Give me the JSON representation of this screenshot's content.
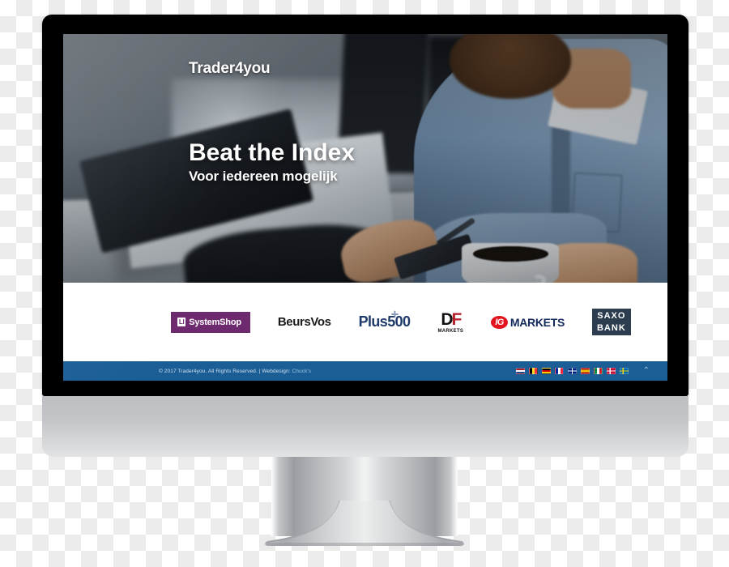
{
  "device": {
    "type": "desktop-monitor",
    "bezel_color": "#000000",
    "chin_color": "#c2c4c7",
    "stand_color": "#c9cbce"
  },
  "site": {
    "logo_text": "Trader4you",
    "hero": {
      "headline": "Beat the Index",
      "subheadline": "Voor iedereen mogelijk",
      "image_description": "bearded man in denim shirt at a cafe table with tablet, stylus and coffee cup",
      "overlay_color": "#0e1216"
    },
    "partners": {
      "label": "partner-logos",
      "items": [
        {
          "id": "systemshop",
          "name": "SystemShop",
          "mark": "LI",
          "bg": "#6e2a6e",
          "fg": "#ffffff"
        },
        {
          "id": "beursvos",
          "name": "BeursVos",
          "fg": "#1a1a1a"
        },
        {
          "id": "plus500",
          "name": "Plus500",
          "fg": "#1e3a6b"
        },
        {
          "id": "dfmarkets",
          "name": "DF",
          "sub": "MARKETS",
          "fg": "#111111",
          "accent": "#b8202e"
        },
        {
          "id": "igmarkets",
          "badge": "IG",
          "name": "MARKETS",
          "badge_bg": "#e2141e",
          "fg": "#13295c"
        },
        {
          "id": "saxobank",
          "line1": "SAXO",
          "line2": "BANK",
          "bg": "#2c3d50",
          "fg": "#ffffff"
        }
      ]
    },
    "footer": {
      "bg": "#1b5e96",
      "copyright": "© 2017 Trader4you. All Rights Reserved. | Webdesign: ",
      "webdesign_credit": "Chuck's",
      "languages": [
        {
          "code": "nl",
          "name": "Netherlands"
        },
        {
          "code": "be",
          "name": "Belgium"
        },
        {
          "code": "de",
          "name": "Germany"
        },
        {
          "code": "fr",
          "name": "France"
        },
        {
          "code": "gb",
          "name": "United Kingdom"
        },
        {
          "code": "es",
          "name": "Spain"
        },
        {
          "code": "it",
          "name": "Italy"
        },
        {
          "code": "dk",
          "name": "Denmark"
        },
        {
          "code": "se",
          "name": "Sweden"
        }
      ],
      "scroll_top_glyph": "⌃"
    }
  }
}
